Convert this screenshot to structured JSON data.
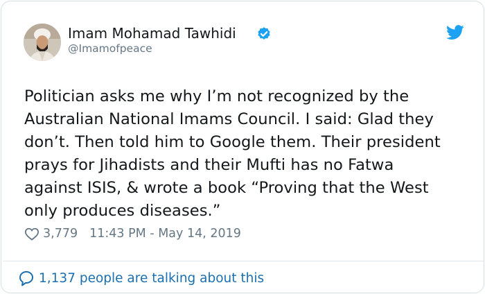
{
  "tweet": {
    "author_name": "Imam Mohamad Tawhidi",
    "author_handle": "@Imamofpeace",
    "text_lines": [
      "Politician asks me why I’m not recognized by the",
      "Australian National Imams Council. I said: Glad they",
      "don’t. Then told him to Google them. Their president",
      "prays for Jihadists and their Mufti has no Fatwa",
      "against ISIS, & wrote a book “Proving that the West",
      "only produces diseases.”"
    ],
    "likes": "3,779",
    "timestamp": "11:43 PM - May 14, 2019",
    "conversation": "1,137 people are talking about this"
  },
  "icons": {
    "verified": "verified-badge-icon",
    "brand": "twitter-bird-icon",
    "like": "heart-icon",
    "reply": "speech-bubble-icon"
  },
  "colors": {
    "accent": "#1da1f2",
    "link": "#1b6fb0",
    "muted": "#657786",
    "text": "#14171a"
  }
}
